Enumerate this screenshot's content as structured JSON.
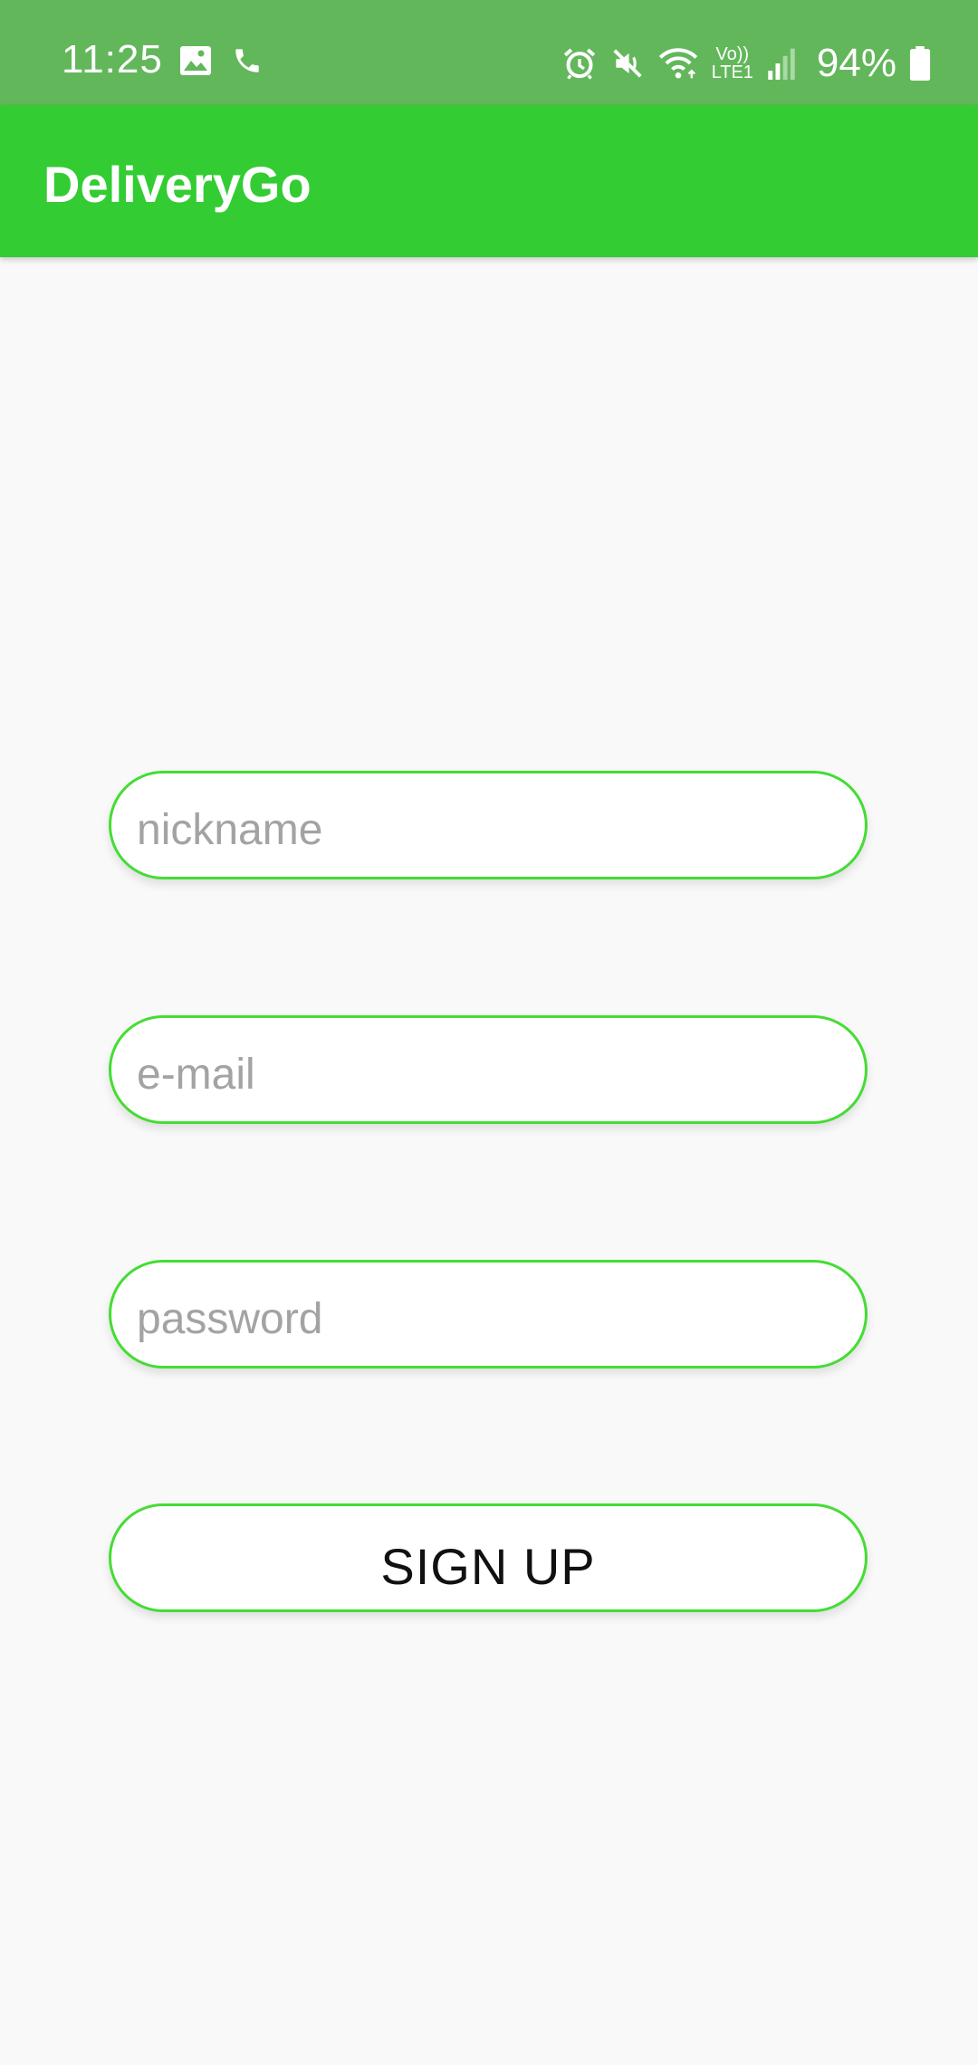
{
  "status_bar": {
    "time": "11:25",
    "battery": "94%",
    "lte_label_top": "Vo))",
    "lte_label_bottom": "LTE1",
    "left_icons": [
      "image-icon",
      "phone-icon"
    ],
    "right_icons": [
      "alarm-icon",
      "mute-icon",
      "wifi-icon",
      "volte-icon",
      "signal-icon",
      "battery-icon"
    ]
  },
  "app_bar": {
    "title": "DeliveryGo",
    "color": "#33cc33"
  },
  "form": {
    "nickname": {
      "value": "",
      "placeholder": "nickname"
    },
    "email": {
      "value": "",
      "placeholder": "e-mail"
    },
    "password": {
      "value": "",
      "placeholder": "password"
    },
    "signup_label": "SIGN UP",
    "accent_color": "#44dd33"
  }
}
